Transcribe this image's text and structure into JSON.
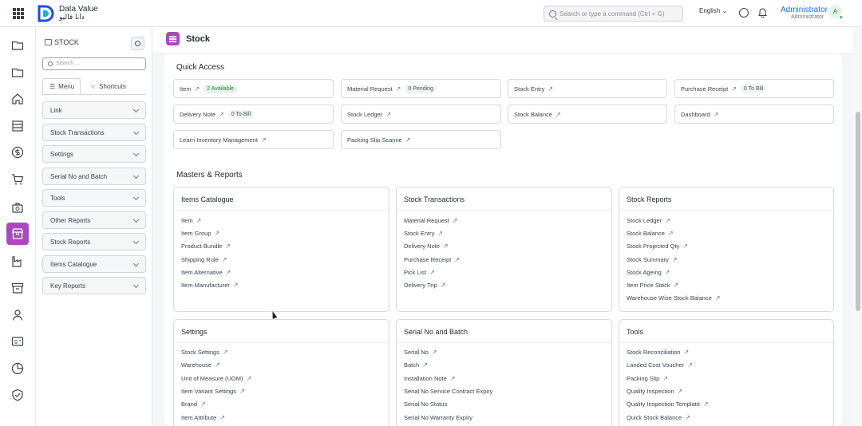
{
  "topbar": {
    "brand_en": "Data Value",
    "brand_ar": "دانا فاليو",
    "search_placeholder": "Search or type a command (Ctrl + G)",
    "language": "English ⌄",
    "user_name": "Administrator",
    "user_role": "Administrator",
    "avatar_letter": "A"
  },
  "rail": {
    "icons": [
      "folder-icon",
      "folder-icon",
      "home-icon",
      "server-icon",
      "dollar-icon",
      "cart-icon",
      "briefcase-icon",
      "stock-icon",
      "factory-icon",
      "archive-icon",
      "people-icon",
      "id-card-icon",
      "pie-chart-icon",
      "shield-check-icon"
    ],
    "active": "stock-icon"
  },
  "sidebar": {
    "title": "STOCK",
    "search_placeholder": "Search ...",
    "tab_menu": "Menu",
    "tab_shortcuts": "Shortcuts",
    "items": [
      "Link",
      "Stock Transactions",
      "Settings",
      "Serial No and Batch",
      "Tools",
      "Other Reports",
      "Stock Reports",
      "Items Catalogue",
      "Key Reports"
    ]
  },
  "page": {
    "title": "Stock"
  },
  "quick_access": {
    "title": "Quick Access",
    "items": [
      {
        "label": "Item",
        "badge": "2 Available"
      },
      {
        "label": "Material Request",
        "badge": "0 Pending"
      },
      {
        "label": "Stock Entry",
        "badge": ""
      },
      {
        "label": "Purchase Receipt",
        "badge": "0 To Bill"
      },
      {
        "label": "Delivery Note",
        "badge": "0 To Bill"
      },
      {
        "label": "Stock Ledger",
        "badge": ""
      },
      {
        "label": "Stock Balance",
        "badge": ""
      },
      {
        "label": "Dashboard",
        "badge": ""
      },
      {
        "label": "Learn Inventory Management",
        "badge": ""
      },
      {
        "label": "Packing Slip Scanne",
        "badge": ""
      }
    ]
  },
  "masters": {
    "title": "Masters & Reports",
    "cards": [
      {
        "title": "Items Catalogue",
        "links": [
          "Item",
          "Item Group",
          "Product Bundle",
          "Shipping Rule",
          "Item Alternative",
          "Item Manufacturer"
        ]
      },
      {
        "title": "Stock Transactions",
        "links": [
          "Material Request",
          "Stock Entry",
          "Delivery Note",
          "Purchase Receipt",
          "Pick List",
          "Delivery Trip"
        ]
      },
      {
        "title": "Stock Reports",
        "links": [
          "Stock Ledger",
          "Stock Balance",
          "Stock Projected Qty",
          "Stock Summary",
          "Stock Ageing",
          "Item Price Stock",
          "Warehouse Wise Stock Balance"
        ]
      },
      {
        "title": "Settings",
        "links": [
          "Stock Settings",
          "Warehouse",
          "Unit of Measure (UOM)",
          "Item Variant Settings",
          "Brand",
          "Item Attribute"
        ]
      },
      {
        "title": "Serial No and Batch",
        "links": [
          "Serial No",
          "Batch",
          "Installation Note",
          "Serial No Service Contract Expiry",
          "Serial No Status",
          "Serial No Warranty Expiry"
        ]
      },
      {
        "title": "Tools",
        "links": [
          "Stock Reconciliation",
          "Landed Cost Voucher",
          "Packing Slip",
          "Quality Inspection",
          "Quality Inspection Template",
          "Quick Stock Balance"
        ]
      }
    ]
  },
  "colors": {
    "accent": "#a64bbf",
    "link_blue": "#1f6bd1",
    "online_green": "#3fbb5b"
  }
}
